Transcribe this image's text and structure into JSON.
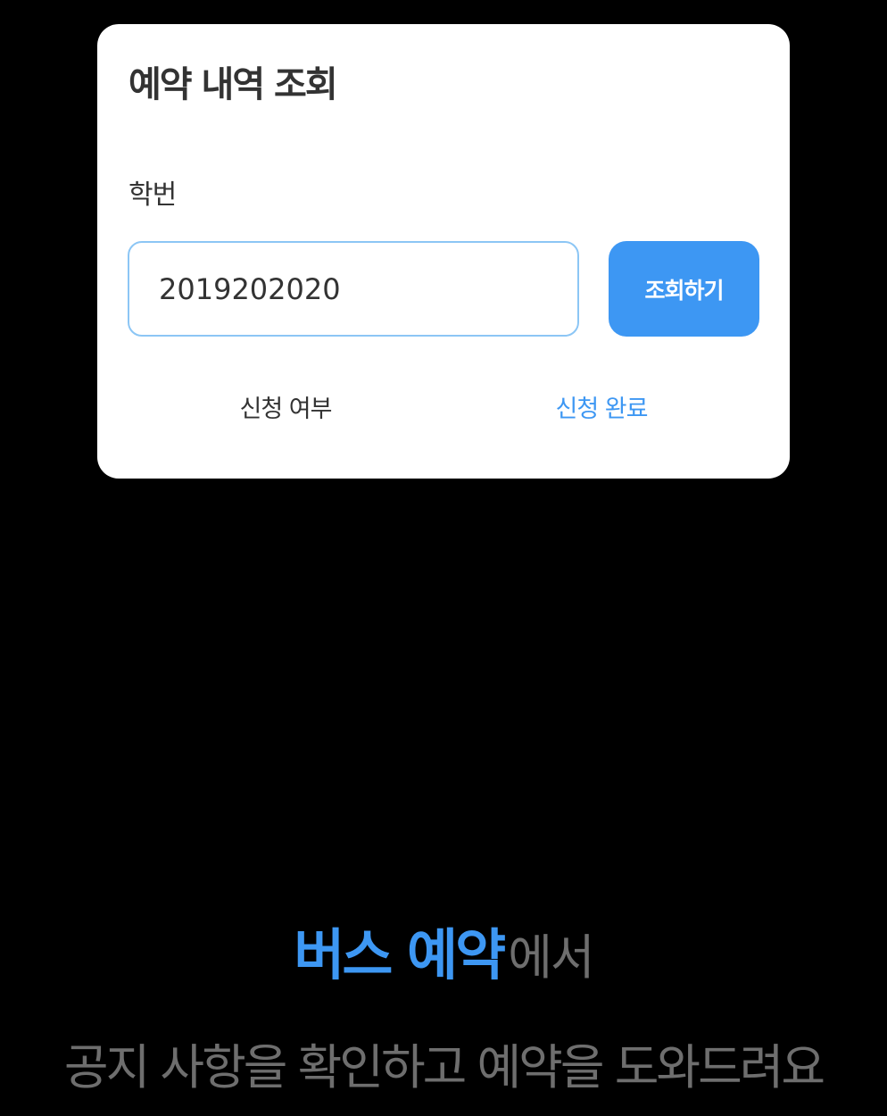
{
  "card": {
    "title": "예약 내역 조회",
    "field_label": "학번",
    "student_id_value": "2019202020",
    "search_button_label": "조회하기",
    "status_label": "신청 여부",
    "status_value": "신청 완료"
  },
  "promo": {
    "highlight": "버스 예약",
    "highlight_rest": "에서",
    "subtitle": "공지 사항을 확인하고 예약을 도와드려요"
  },
  "colors": {
    "accent": "#3d97f3",
    "input_border": "#8cc6f5",
    "background": "#000000",
    "card": "#ffffff",
    "text_dark": "#333333",
    "text_gray": "#6e6e6e"
  }
}
